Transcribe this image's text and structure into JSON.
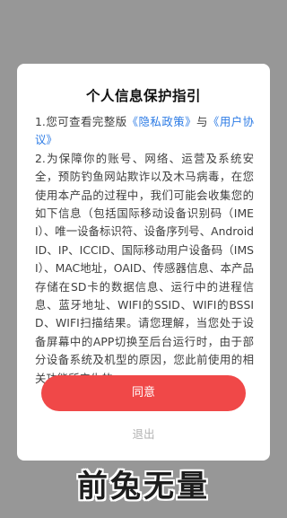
{
  "dialog": {
    "title": "个人信息保护指引",
    "item1_prefix": "1.您可查看完整版",
    "privacy_link": "《隐私政策》",
    "item1_connector": "与",
    "user_agreement_link": "《用户协议》",
    "item2": "2.为保障你的账号、网络、运营及系统安全，预防钓鱼网站欺诈以及木马病毒，在您使用本产品的过程中，我们可能会收集您的如下信息（包括国际移动设备识别码（IMEI）、唯一设备标识符、设备序列号、Android ID、IP、ICCID、国际移动用户设备码（IMSI）、MAC地址，OAID、传感器信息、本产品存储在SD卡的数据信息、运行中的进程信息、蓝牙地址、WIFI的SSID、WIFI的BSSID、WIFI扫描结果。请您理解，当您处于设备屏幕中的APP切换至后台运行时，由于部分设备系统及机型的原因，您此前使用的相关功能所产生的",
    "agree_label": "同意",
    "exit_label": "退出"
  },
  "watermark": {
    "text": "前兔无量"
  },
  "colors": {
    "overlay": "#979797",
    "accent": "#f04848",
    "link": "#2c7be5"
  }
}
